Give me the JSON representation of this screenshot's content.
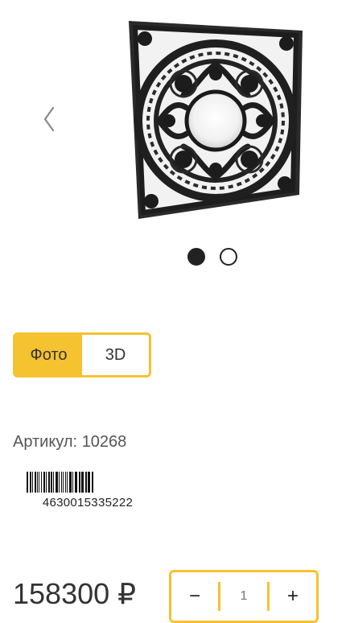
{
  "gallery": {
    "prev_icon": "chevron-left-icon",
    "image_alt": "decorative metal panel",
    "slides_total": 2,
    "active_slide": 1
  },
  "view_toggle": {
    "photo_label": "Фото",
    "three_d_label": "3D",
    "active": "photo"
  },
  "product": {
    "article_label": "Артикул:",
    "article_number": "10268",
    "barcode_number": "4630015335222",
    "price": "158300",
    "currency": "₽"
  },
  "quantity": {
    "minus_label": "−",
    "plus_label": "+",
    "value": "1"
  },
  "colors": {
    "accent": "#f5c230",
    "text": "#333333",
    "dot_active": "#222222"
  }
}
